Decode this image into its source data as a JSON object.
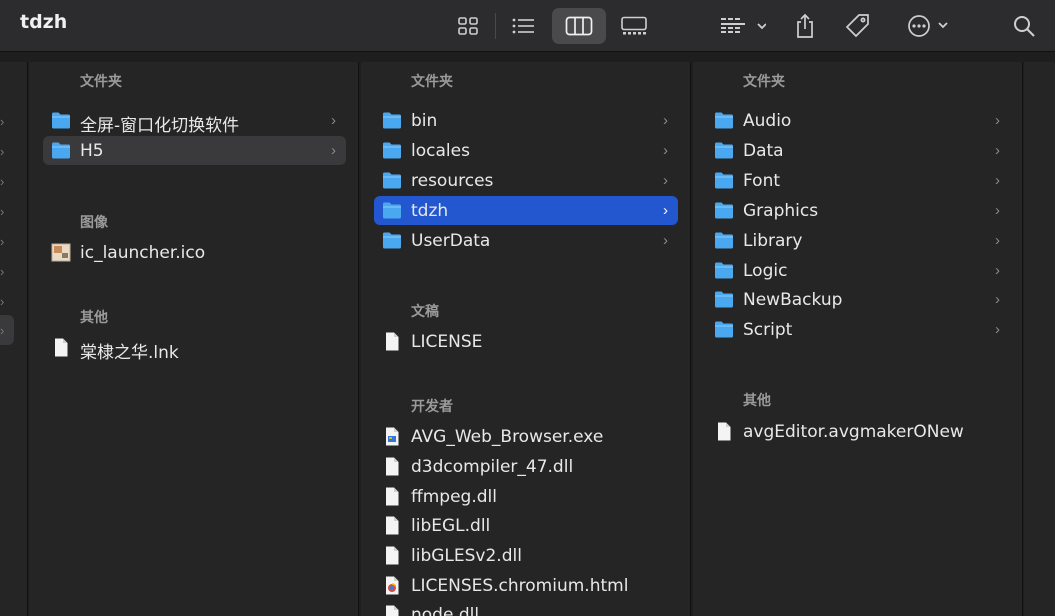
{
  "window": {
    "title": "tdzh"
  },
  "toolbar": {
    "icons": [
      "icon-view-icon",
      "list-view-icon",
      "column-view-icon",
      "gallery-view-icon",
      "group-by-icon",
      "share-icon",
      "tag-icon",
      "more-actions-icon",
      "search-icon"
    ],
    "active_view": "column-view"
  },
  "columns": [
    {
      "sections": [
        {
          "header": "文件夹",
          "items": [
            {
              "name": "全屏-窗口化切换软件",
              "kind": "folder",
              "chevron": true
            },
            {
              "name": "H5",
              "kind": "folder",
              "chevron": true,
              "selected": "gray"
            }
          ]
        },
        {
          "header": "图像",
          "items": [
            {
              "name": "ic_launcher.ico",
              "kind": "image"
            }
          ]
        },
        {
          "header": "其他",
          "items": [
            {
              "name": "棠棣之华.lnk",
              "kind": "doc"
            }
          ]
        }
      ]
    },
    {
      "sections": [
        {
          "header": "文件夹",
          "items": [
            {
              "name": "bin",
              "kind": "folder",
              "chevron": true
            },
            {
              "name": "locales",
              "kind": "folder",
              "chevron": true
            },
            {
              "name": "resources",
              "kind": "folder",
              "chevron": true
            },
            {
              "name": "tdzh",
              "kind": "folder",
              "chevron": true,
              "selected": "blue"
            },
            {
              "name": "UserData",
              "kind": "folder",
              "chevron": true
            }
          ]
        },
        {
          "header": "文稿",
          "items": [
            {
              "name": "LICENSE",
              "kind": "doc"
            }
          ]
        },
        {
          "header": "开发者",
          "items": [
            {
              "name": "AVG_Web_Browser.exe",
              "kind": "exe"
            },
            {
              "name": "d3dcompiler_47.dll",
              "kind": "doc"
            },
            {
              "name": "ffmpeg.dll",
              "kind": "doc"
            },
            {
              "name": "libEGL.dll",
              "kind": "doc"
            },
            {
              "name": "libGLESv2.dll",
              "kind": "doc"
            },
            {
              "name": "LICENSES.chromium.html",
              "kind": "html"
            },
            {
              "name": "node.dll",
              "kind": "doc"
            }
          ]
        }
      ]
    },
    {
      "sections": [
        {
          "header": "文件夹",
          "items": [
            {
              "name": "Audio",
              "kind": "folder",
              "chevron": true
            },
            {
              "name": "Data",
              "kind": "folder",
              "chevron": true
            },
            {
              "name": "Font",
              "kind": "folder",
              "chevron": true
            },
            {
              "name": "Graphics",
              "kind": "folder",
              "chevron": true
            },
            {
              "name": "Library",
              "kind": "folder",
              "chevron": true
            },
            {
              "name": "Logic",
              "kind": "folder",
              "chevron": true
            },
            {
              "name": "NewBackup",
              "kind": "folder",
              "chevron": true
            },
            {
              "name": "Script",
              "kind": "folder",
              "chevron": true
            }
          ]
        },
        {
          "header": "其他",
          "items": [
            {
              "name": "avgEditor.avgmakerONew",
              "kind": "doc"
            }
          ]
        }
      ]
    }
  ],
  "colors": {
    "accent": "#2357d0",
    "folder": "#4aa8f0",
    "background": "#252526",
    "toolbar": "#2c2c2e"
  }
}
